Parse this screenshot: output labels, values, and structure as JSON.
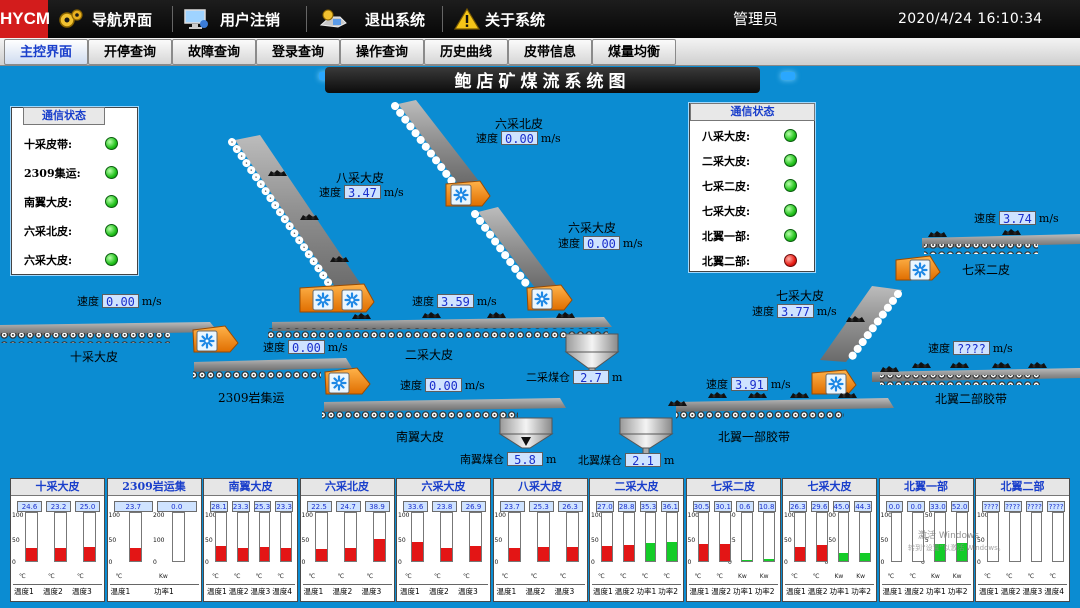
{
  "titlebar": {
    "logo": "HYCM",
    "buttons": [
      {
        "label": "导航界面",
        "icon": "gears-icon"
      },
      {
        "label": "用户注销",
        "icon": "monitor-icon"
      },
      {
        "label": "退出系统",
        "icon": "exit-icon"
      },
      {
        "label": "关于系统",
        "icon": "warning-icon"
      }
    ],
    "user": "管理员",
    "datetime": "2020/4/24 16:10:34"
  },
  "tabs": [
    "主控界面",
    "开停查询",
    "故障查询",
    "登录查询",
    "操作查询",
    "历史曲线",
    "皮带信息",
    "煤量均衡"
  ],
  "active_tab": "主控界面",
  "system_title": "鲍店矿煤流系统图",
  "comm_left": {
    "title": "通信状态",
    "rows": [
      {
        "label": "十采皮带:",
        "status": "ok"
      },
      {
        "label": "2309集运:",
        "status": "ok"
      },
      {
        "label": "南翼大皮:",
        "status": "ok"
      },
      {
        "label": "六采北皮:",
        "status": "ok"
      },
      {
        "label": "六采大皮:",
        "status": "ok"
      }
    ]
  },
  "comm_right": {
    "title": "通信状态",
    "rows": [
      {
        "label": "八采大皮:",
        "status": "ok"
      },
      {
        "label": "二采大皮:",
        "status": "ok"
      },
      {
        "label": "七采二皮:",
        "status": "ok"
      },
      {
        "label": "七采大皮:",
        "status": "ok"
      },
      {
        "label": "北翼一部:",
        "status": "ok"
      },
      {
        "label": "北翼二部:",
        "status": "fault"
      }
    ]
  },
  "colors": {
    "ok": "#22c21c",
    "fault": "#e81c14",
    "bar_red": "#e31515",
    "bar_green": "#14cc28",
    "background": "#0b8cd2"
  },
  "speed_label": "速度",
  "speed_unit": "m/s",
  "bunker_unit": "m",
  "conveyors": {
    "shicai": {
      "name": "十采大皮",
      "speed": "0.00"
    },
    "ji2309": {
      "name": "2309岩集运",
      "speed": "0.00"
    },
    "nanyi": {
      "name": "南翼大皮",
      "speed": "0.00"
    },
    "liucai_bei": {
      "name": "六采北皮",
      "speed": "0.00"
    },
    "liucai_da": {
      "name": "六采大皮",
      "speed": "0.00"
    },
    "bacai": {
      "name": "八采大皮",
      "speed": "3.47"
    },
    "ercai": {
      "name": "二采大皮",
      "speed": "3.59"
    },
    "qicai_er": {
      "name": "七采二皮",
      "speed": "3.74"
    },
    "qicai_da": {
      "name": "七采大皮",
      "speed": "3.77"
    },
    "beiyi_er": {
      "name": "北翼二部胶带",
      "speed": "????"
    },
    "beiyi_yi": {
      "name": "北翼一部胶带",
      "speed": "3.91"
    }
  },
  "bunkers": {
    "ercai": {
      "name": "二采煤仓",
      "level": "2.7"
    },
    "nanyi": {
      "name": "南翼煤仓",
      "level": "5.8"
    },
    "beiyi": {
      "name": "北翼煤仓",
      "level": "2.1"
    }
  },
  "panels": [
    {
      "title": "十采大皮",
      "cols": [
        {
          "val": "24.6",
          "label": "温度1",
          "pct": 0.28,
          "color": "red"
        },
        {
          "val": "23.2",
          "label": "温度2",
          "pct": 0.27,
          "color": "red"
        },
        {
          "val": "25.0",
          "label": "温度3",
          "pct": 0.29,
          "color": "red"
        }
      ],
      "scales": [
        [
          "100",
          "50",
          "0"
        ]
      ],
      "unit": "℃"
    },
    {
      "title": "2309岩运集",
      "cols": [
        {
          "val": "23.7",
          "label": "温度1",
          "pct": 0.27,
          "color": "red"
        },
        {
          "val": "0.0",
          "label": "功率1",
          "pct": 0,
          "color": "green"
        }
      ],
      "scales": [
        [
          "100",
          "50",
          "0"
        ],
        [
          "200",
          "100",
          "0"
        ]
      ],
      "unit": "℃",
      "unit2": "Kw"
    },
    {
      "title": "南翼大皮",
      "cols": [
        {
          "val": "28.1",
          "label": "温度1",
          "pct": 0.32,
          "color": "red"
        },
        {
          "val": "23.3",
          "label": "温度2",
          "pct": 0.27,
          "color": "red"
        },
        {
          "val": "25.3",
          "label": "温度3",
          "pct": 0.29,
          "color": "red"
        },
        {
          "val": "23.3",
          "label": "温度4",
          "pct": 0.27,
          "color": "red"
        }
      ],
      "scales": [
        [
          "100",
          "50",
          "0"
        ]
      ],
      "unit": "℃"
    },
    {
      "title": "六采北皮",
      "cols": [
        {
          "val": "22.5",
          "label": "温度1",
          "pct": 0.26,
          "color": "red"
        },
        {
          "val": "24.7",
          "label": "温度2",
          "pct": 0.28,
          "color": "red"
        },
        {
          "val": "38.9",
          "label": "温度3",
          "pct": 0.45,
          "color": "red"
        }
      ],
      "scales": [
        [
          "100",
          "50",
          "0"
        ]
      ],
      "unit": "℃"
    },
    {
      "title": "六采大皮",
      "cols": [
        {
          "val": "33.6",
          "label": "温度1",
          "pct": 0.39,
          "color": "red"
        },
        {
          "val": "23.8",
          "label": "温度2",
          "pct": 0.27,
          "color": "red"
        },
        {
          "val": "26.9",
          "label": "温度3",
          "pct": 0.31,
          "color": "red"
        }
      ],
      "scales": [
        [
          "100",
          "50",
          "0"
        ]
      ],
      "unit": "℃"
    },
    {
      "title": "八采大皮",
      "cols": [
        {
          "val": "23.7",
          "label": "温度1",
          "pct": 0.27,
          "color": "red"
        },
        {
          "val": "25.3",
          "label": "温度2",
          "pct": 0.29,
          "color": "red"
        },
        {
          "val": "26.3",
          "label": "温度3",
          "pct": 0.3,
          "color": "red"
        }
      ],
      "scales": [
        [
          "100",
          "50",
          "0"
        ]
      ],
      "unit": "℃"
    },
    {
      "title": "二采大皮",
      "cols": [
        {
          "val": "27.0",
          "label": "温度1",
          "pct": 0.31,
          "color": "red"
        },
        {
          "val": "28.8",
          "label": "温度2",
          "pct": 0.33,
          "color": "red"
        },
        {
          "val": "35.3",
          "label": "功率1",
          "pct": 0.38,
          "color": "green"
        },
        {
          "val": "36.1",
          "label": "功率2",
          "pct": 0.39,
          "color": "green"
        }
      ],
      "scales": [
        [
          "100",
          "50",
          "0"
        ]
      ],
      "unit": "℃"
    },
    {
      "title": "七采二皮",
      "cols": [
        {
          "val": "30.5",
          "label": "温度1",
          "pct": 0.35,
          "color": "red"
        },
        {
          "val": "30.1",
          "label": "温度2",
          "pct": 0.35,
          "color": "red"
        },
        {
          "val": "0.6",
          "label": "功率1",
          "pct": 0.02,
          "color": "green"
        },
        {
          "val": "10.8",
          "label": "功率2",
          "pct": 0.05,
          "color": "green"
        }
      ],
      "scales": [
        [
          "100",
          "50",
          "0"
        ],
        [
          "50",
          "25",
          "0"
        ]
      ],
      "unit": "℃",
      "unit2": "Kw"
    },
    {
      "title": "七采大皮",
      "cols": [
        {
          "val": "26.3",
          "label": "温度1",
          "pct": 0.3,
          "color": "red"
        },
        {
          "val": "29.6",
          "label": "温度2",
          "pct": 0.34,
          "color": "red"
        },
        {
          "val": "45.0",
          "label": "功率1",
          "pct": 0.17,
          "color": "green"
        },
        {
          "val": "44.3",
          "label": "功率2",
          "pct": 0.16,
          "color": "green"
        }
      ],
      "scales": [
        [
          "100",
          "50",
          "0"
        ],
        [
          "300",
          "150",
          "0"
        ]
      ],
      "unit": "℃",
      "unit2": "Kw"
    },
    {
      "title": "北翼一部",
      "cols": [
        {
          "val": "0.0",
          "label": "温度1",
          "pct": 0,
          "color": "red"
        },
        {
          "val": "0.0",
          "label": "温度2",
          "pct": 0,
          "color": "red"
        },
        {
          "val": "33.0",
          "label": "功率1",
          "pct": 0.36,
          "color": "green"
        },
        {
          "val": "52.0",
          "label": "功率2",
          "pct": 0.38,
          "color": "green"
        }
      ],
      "scales": [
        [
          "100",
          "50",
          "0"
        ],
        [
          "150",
          "75",
          "0"
        ]
      ],
      "unit": "℃",
      "unit2": "Kw"
    },
    {
      "title": "北翼二部",
      "cols": [
        {
          "val": "????",
          "label": "温度1",
          "pct": 0,
          "color": "red"
        },
        {
          "val": "????",
          "label": "温度2",
          "pct": 0,
          "color": "red"
        },
        {
          "val": "????",
          "label": "温度3",
          "pct": 0,
          "color": "red"
        },
        {
          "val": "????",
          "label": "温度4",
          "pct": 0,
          "color": "red"
        }
      ],
      "scales": [
        [
          "100",
          "50",
          "0"
        ]
      ],
      "unit": "℃"
    }
  ],
  "watermark": {
    "line1": "激活 Windows",
    "line2": "转到“设置”以激活 Windows。"
  }
}
